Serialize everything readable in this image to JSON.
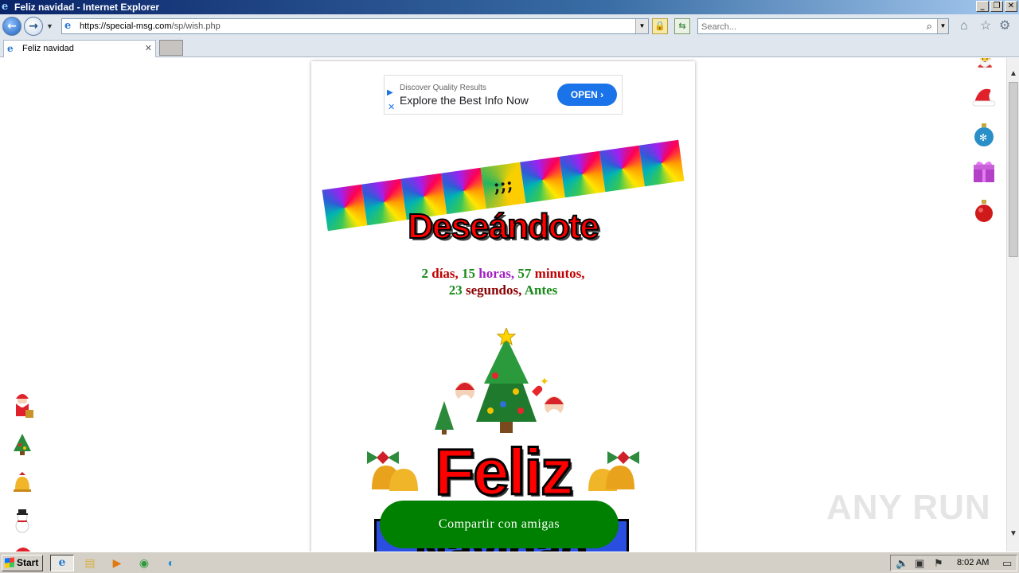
{
  "window": {
    "title": "Feliz navidad - Internet Explorer",
    "controls": [
      "_",
      "❐",
      "✕"
    ]
  },
  "nav": {
    "back_icon": "back-arrow-icon",
    "forward_icon": "forward-arrow-icon",
    "url_host": "https://special-msg.com",
    "url_path": "/sp/wish.php",
    "search_placeholder": "Search..."
  },
  "tabs": [
    {
      "label": "Feliz navidad"
    }
  ],
  "ad": {
    "subtitle": "Discover Quality Results",
    "title": "Explore the Best Info Now",
    "button": "OPEN ›"
  },
  "banner": {
    "center_text": ";;;"
  },
  "heading": "Deseándote",
  "countdown": {
    "days_num": "2",
    "days_label": "días,",
    "hours_num": "15",
    "hours_label": "horas,",
    "minutes_num": "57",
    "minutes_label": "minutos,",
    "seconds_num": "23",
    "seconds_label": "segundos,",
    "suffix": "Antes"
  },
  "greeting": {
    "line1": "Feliz",
    "line2": "Navidad"
  },
  "share_button": "Compartir con amigas",
  "watermark": "ANY RUN",
  "taskbar": {
    "start_label": "Start",
    "clock": "8:02 AM"
  },
  "colors": {
    "accent_green": "#008000",
    "heading_red": "#ff0000",
    "ad_blue": "#1a73e8",
    "navidad_blue": "#2a4fe0"
  }
}
